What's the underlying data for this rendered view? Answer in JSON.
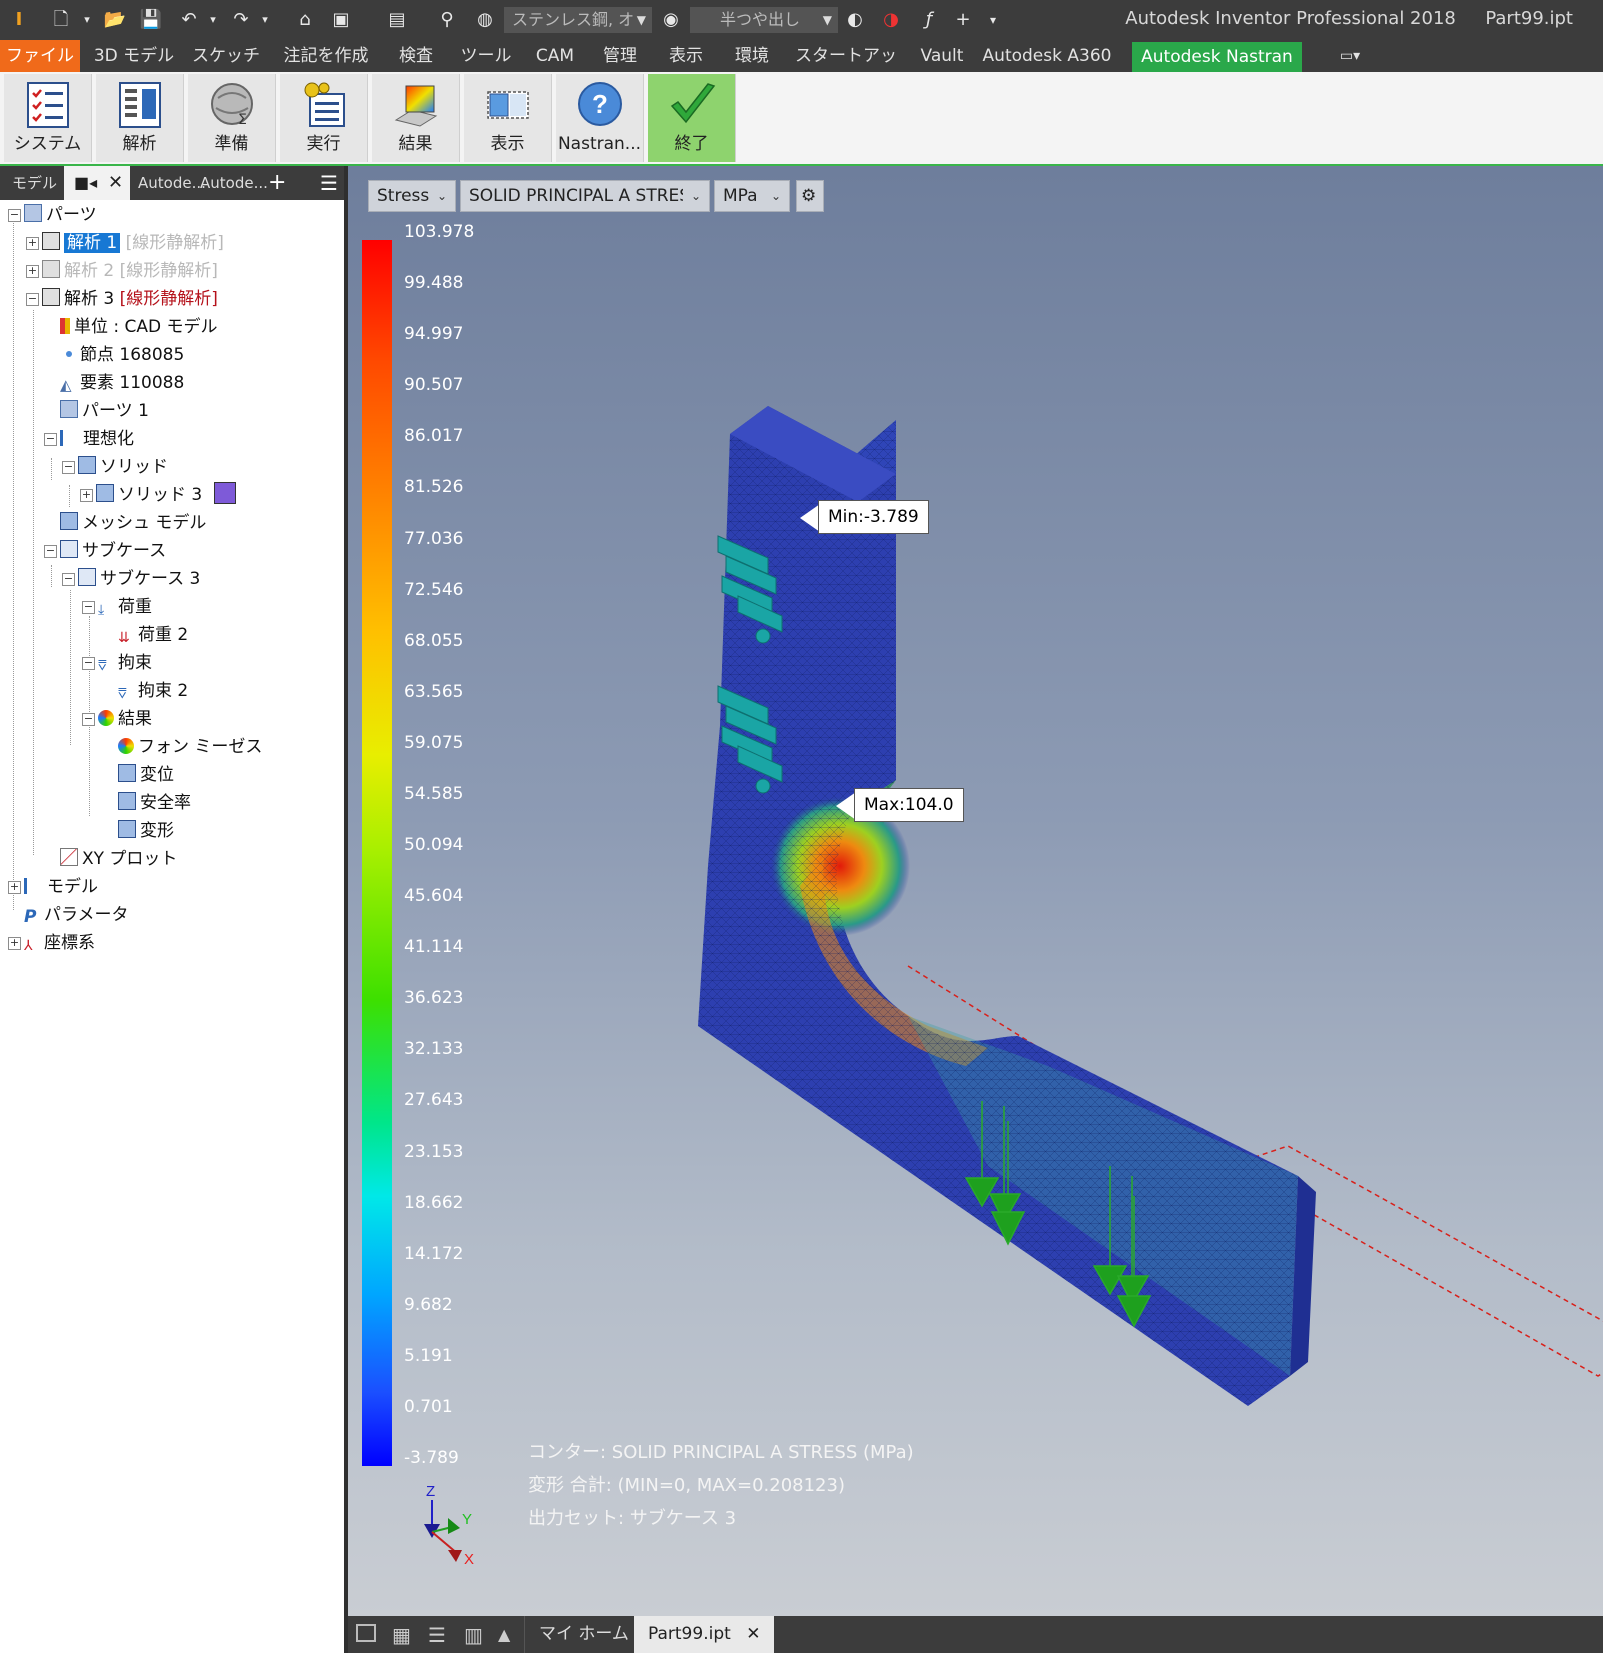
{
  "window": {
    "app_title": "Autodesk Inventor Professional 2018",
    "file_name": "Part99.ipt"
  },
  "qat": {
    "material": "ステンレス鋼, オ",
    "appearance": "半つや出し"
  },
  "ribbon_tabs": [
    "ファイル",
    "3D モデル",
    "スケッチ",
    "注記を作成",
    "検査",
    "ツール",
    "CAM",
    "管理",
    "表示",
    "環境",
    "スタートアップ",
    "Vault",
    "Autodesk A360",
    "Autodesk Nastran"
  ],
  "ribbon_buttons": [
    "システム",
    "解析",
    "準備",
    "実行",
    "結果",
    "表示",
    "Nastran...",
    "終了"
  ],
  "browser": {
    "tabs": {
      "model": "モデル",
      "tab2": "Autode...",
      "tab3": "Autode..."
    },
    "tree": {
      "root": "パーツ",
      "analysis1": "解析 1",
      "analysis1_type": "[線形静解析]",
      "analysis2": "解析 2",
      "analysis2_type": "[線形静解析]",
      "analysis3": "解析 3",
      "analysis3_type": "[線形静解析]",
      "units": "単位 : CAD モデル",
      "nodes": "節点 168085",
      "elements": "要素 110088",
      "parts1": "パーツ 1",
      "idealization": "理想化",
      "solid": "ソリッド",
      "solid3": "ソリッド 3",
      "mesh_model": "メッシュ モデル",
      "subcase": "サブケース",
      "subcase3": "サブケース 3",
      "loads": "荷重",
      "load2": "荷重 2",
      "constraints": "拘束",
      "constraint2": "拘束 2",
      "results": "結果",
      "von_mises": "フォン ミーゼス",
      "displacement": "変位",
      "safety_factor": "安全率",
      "deformation": "変形",
      "xy_plot": "XY プロット",
      "model": "モデル",
      "parameters": "パラメータ",
      "coord_system": "座標系"
    }
  },
  "viewport": {
    "result_type": "Stress",
    "component": "SOLID PRINCIPAL A STRESS",
    "unit": "MPa",
    "legend_values": [
      "103.978",
      "99.488",
      "94.997",
      "90.507",
      "86.017",
      "81.526",
      "77.036",
      "72.546",
      "68.055",
      "63.565",
      "59.075",
      "54.585",
      "50.094",
      "45.604",
      "41.114",
      "36.623",
      "32.133",
      "27.643",
      "23.153",
      "18.662",
      "14.172",
      "9.682",
      "5.191",
      "0.701",
      "-3.789"
    ],
    "min_label": "Min:-3.789",
    "max_label": "Max:104.0",
    "triad": {
      "z": "Z",
      "y": "Y",
      "x": "X"
    },
    "status": {
      "contour": "コンター: SOLID PRINCIPAL A STRESS (MPa)",
      "deformation": "変形 合計: (MIN=0, MAX=0.208123)",
      "output_set": "出力セット: サブケース 3"
    }
  },
  "doc_tabs": {
    "home": "マイ ホーム",
    "part": "Part99.ipt"
  },
  "colors": {
    "file_tab": "#f06a1a",
    "active_tab": "#2aa84a",
    "selection": "#1778d4",
    "finish_button": "#8ed36e"
  }
}
